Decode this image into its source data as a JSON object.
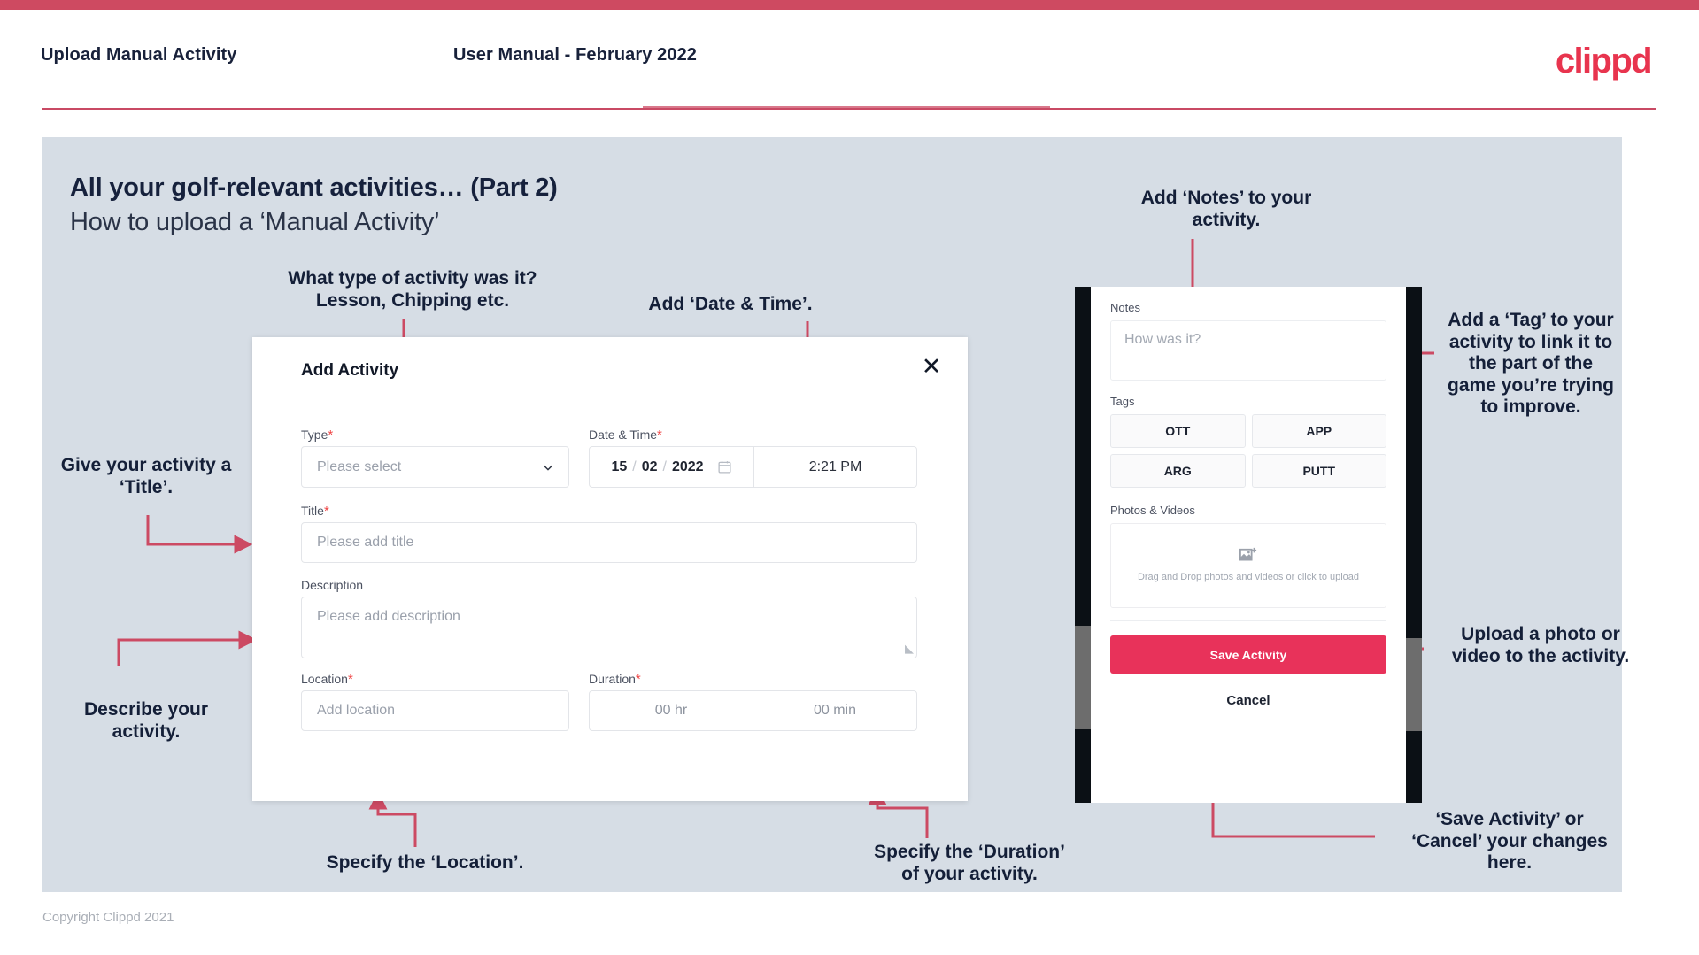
{
  "header": {
    "title": "Upload Manual Activity",
    "subtitle": "User Manual - February 2022",
    "logo": "clippd"
  },
  "slide": {
    "heading": "All your golf-relevant activities… (Part 2)",
    "subheading": "How to upload a ‘Manual Activity’",
    "footer": "Copyright Clippd 2021"
  },
  "modal": {
    "title": "Add Activity",
    "close_label": "✕",
    "fields": {
      "type": {
        "label": "Type",
        "required": "*",
        "placeholder": "Please select"
      },
      "datetime": {
        "label": "Date & Time",
        "required": "*",
        "day": "15",
        "month": "02",
        "year": "2022",
        "time": "2:21 PM"
      },
      "title": {
        "label": "Title",
        "required": "*",
        "placeholder": "Please add title"
      },
      "description": {
        "label": "Description",
        "required": "",
        "placeholder": "Please add description"
      },
      "location": {
        "label": "Location",
        "required": "*",
        "placeholder": "Add location"
      },
      "duration": {
        "label": "Duration",
        "required": "*",
        "hours": "00 hr",
        "minutes": "00 min"
      }
    }
  },
  "phone": {
    "notes_label": "Notes",
    "notes_placeholder": "How was it?",
    "tags_label": "Tags",
    "tags": [
      "OTT",
      "APP",
      "ARG",
      "PUTT"
    ],
    "photos_label": "Photos & Videos",
    "dropzone_text": "Drag and Drop photos and videos or click to upload",
    "save_label": "Save Activity",
    "cancel_label": "Cancel"
  },
  "annotations": {
    "type": "What type of activity was it?\nLesson, Chipping etc.",
    "datetime": "Add ‘Date & Time’.",
    "title": "Give your activity a\n‘Title’.",
    "description": "Describe your\nactivity.",
    "location": "Specify the ‘Location’.",
    "duration": "Specify the ‘Duration’\nof your activity.",
    "notes": "Add ‘Notes’ to your\nactivity.",
    "tags": "Add a ‘Tag’ to your\nactivity to link it to\nthe part of the\ngame you’re trying\nto improve.",
    "upload": "Upload a photo or\nvideo to the activity.",
    "save": "‘Save Activity’ or\n‘Cancel’ your changes\nhere."
  },
  "colors": {
    "accent": "#e8344e",
    "accent_bar": "#ce4a61",
    "arrow": "#cc4a63",
    "panel": "#d6dde5",
    "text_dark": "#16213c"
  }
}
